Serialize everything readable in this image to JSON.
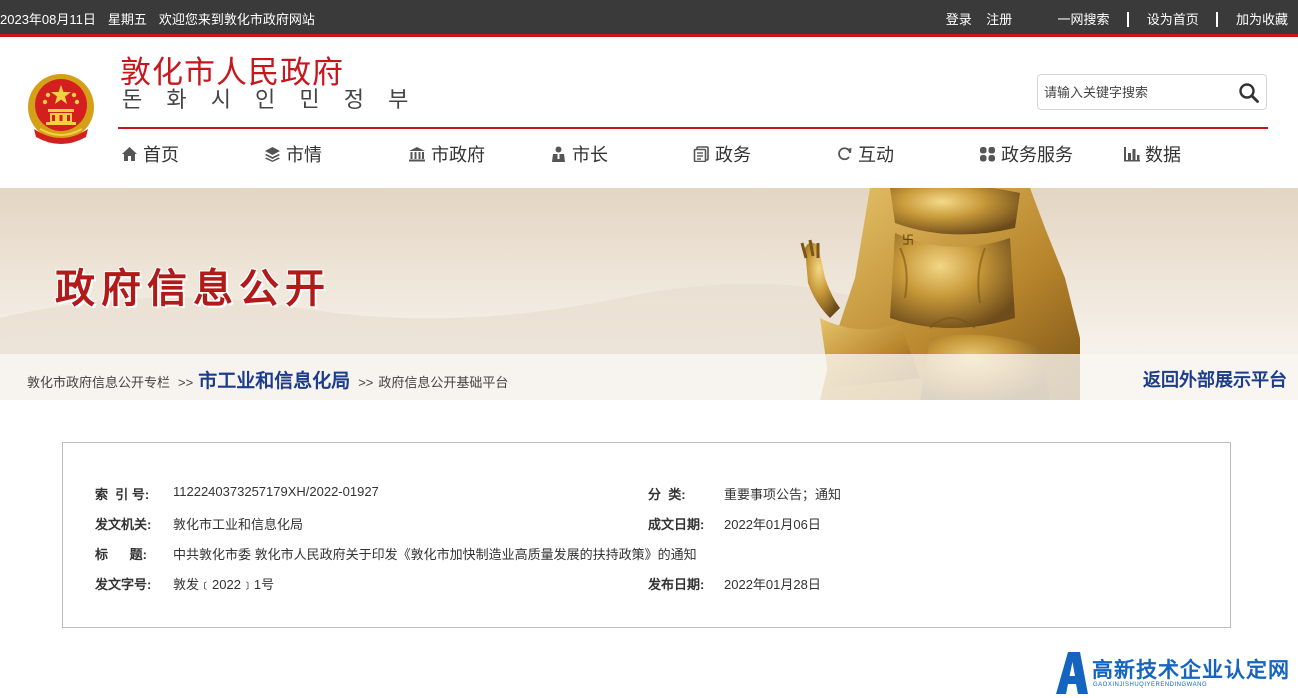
{
  "topbar": {
    "date": "2023年08月11日",
    "weekday": "星期五",
    "welcome": "欢迎您来到敦化市政府网站",
    "login": "登录",
    "register": "注册",
    "site_search": "一网搜索",
    "set_homepage": "设为首页",
    "add_favorite": "加为收藏"
  },
  "header": {
    "title": "敦化市人民政府",
    "subtitle": "돈 화 시 인 민 정 부",
    "search_placeholder": "请输入关键字搜索"
  },
  "nav": [
    {
      "label": "首页",
      "icon": "home-icon"
    },
    {
      "label": "市情",
      "icon": "layers-icon"
    },
    {
      "label": "市政府",
      "icon": "building-icon"
    },
    {
      "label": "市长",
      "icon": "people-icon"
    },
    {
      "label": "政务",
      "icon": "document-icon"
    },
    {
      "label": "互动",
      "icon": "refresh-icon"
    },
    {
      "label": "政务服务",
      "icon": "grid-icon"
    },
    {
      "label": "数据",
      "icon": "bar-chart-icon"
    }
  ],
  "banner": {
    "title": "政府信息公开"
  },
  "breadcrumb": {
    "root": "敦化市政府信息公开专栏",
    "sep": ">>",
    "department": "市工业和信息化局",
    "platform": "政府信息公开基础平台",
    "back_link": "返回外部展示平台"
  },
  "info": {
    "index_label": "索  引 号:",
    "index_value": "1122240373257179XH/2022-01927",
    "category_label": "分  类:",
    "category_value": "重要事项公告；通知",
    "issuer_label": "发文机关:",
    "issuer_value": "敦化市工业和信息化局",
    "date_written_label": "成文日期:",
    "date_written_value": "2022年01月06日",
    "title_label": "标      题:",
    "title_value": "中共敦化市委 敦化市人民政府关于印发《敦化市加快制造业高质量发展的扶持政策》的通知",
    "doc_number_label": "发文字号:",
    "doc_number_value": "敦发﹝2022﹞1号",
    "publish_date_label": "发布日期:",
    "publish_date_value": "2022年01月28日"
  },
  "watermark": {
    "text": "高新技术企业认定网",
    "sub": "GAOXINJISHUQIYERENDINGWANG"
  },
  "colors": {
    "brand_red": "#c8161d",
    "topbar_bg": "#3a3a3a",
    "link_blue": "#1c3c8c",
    "watermark_blue": "#1565c0"
  }
}
